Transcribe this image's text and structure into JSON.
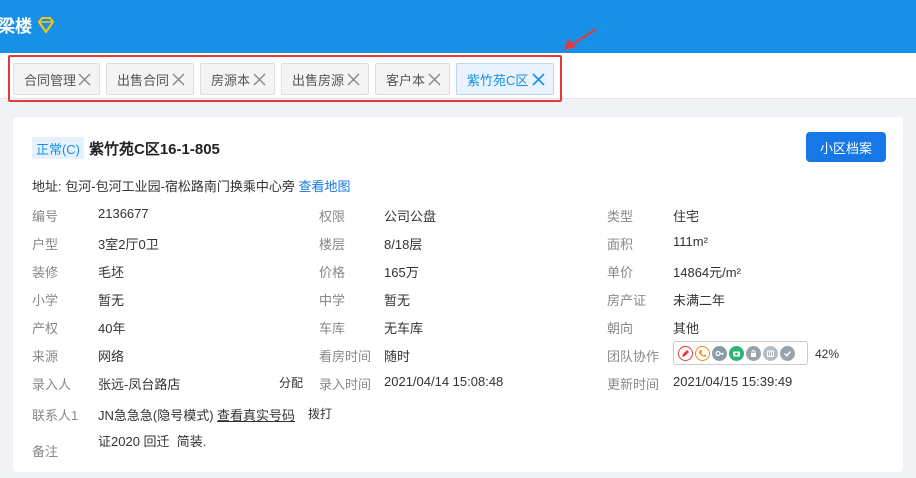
{
  "app": {
    "title": "梁楼"
  },
  "tabs": [
    {
      "label": "合同管理"
    },
    {
      "label": "出售合同"
    },
    {
      "label": "房源本"
    },
    {
      "label": "出售房源"
    },
    {
      "label": "客户本"
    },
    {
      "label": "紫竹苑C区",
      "active": true
    }
  ],
  "header": {
    "status_badge": "正常(C)",
    "title": "紫竹苑C区16-1-805",
    "archive_button": "小区档案"
  },
  "address": {
    "label": "地址:",
    "value": "包河-包河工业园-宿松路南门换乘中心旁",
    "map_link": "查看地图"
  },
  "fields": {
    "col1": [
      {
        "label": "编号",
        "value": "2136677"
      },
      {
        "label": "户型",
        "value": "3室2厅0卫"
      },
      {
        "label": "装修",
        "value": "毛坯"
      },
      {
        "label": "小学",
        "value": "暂无"
      },
      {
        "label": "产权",
        "value": "40年"
      },
      {
        "label": "来源",
        "value": "网络"
      },
      {
        "label": "录入人",
        "value": "张远-凤台路店",
        "action": "分配"
      }
    ],
    "col2": [
      {
        "label": "权限",
        "value": "公司公盘"
      },
      {
        "label": "楼层",
        "value": "8/18层"
      },
      {
        "label": "价格",
        "value": "165万"
      },
      {
        "label": "中学",
        "value": "暂无"
      },
      {
        "label": "车库",
        "value": "无车库"
      },
      {
        "label": "看房时间",
        "value": "随时"
      },
      {
        "label": "录入时间",
        "value": "2021/04/14 15:08:48"
      }
    ],
    "col3": [
      {
        "label": "类型",
        "value": "住宅"
      },
      {
        "label": "面积",
        "value": "111m²"
      },
      {
        "label": "单价",
        "value": "14864元/m²"
      },
      {
        "label": "房产证",
        "value": "未满二年"
      },
      {
        "label": "朝向",
        "value": "其他"
      },
      {
        "label": "团队协作",
        "value": "42%"
      },
      {
        "label": "更新时间",
        "value": "2021/04/15 15:39:49"
      }
    ]
  },
  "contact": {
    "label": "联系人1",
    "name": "JN急急急(隐号模式)",
    "reveal_link": "查看真实号码",
    "dial_link": "拨打"
  },
  "remark": {
    "label": "备注",
    "value": "证2020 回迁  简装."
  },
  "team_icons": [
    {
      "icon": "pen-icon",
      "color": "#e5383b"
    },
    {
      "icon": "phone-icon",
      "color": "#f08c1a"
    },
    {
      "icon": "key-icon",
      "color": "#8a9aa8"
    },
    {
      "icon": "camera-icon",
      "color": "#2bb673"
    },
    {
      "icon": "lock-icon",
      "color": "#9aa3ab"
    },
    {
      "icon": "shop-icon",
      "color": "#b5bcc3"
    },
    {
      "icon": "check-icon",
      "color": "#9aa3ab"
    }
  ],
  "colors": {
    "primary": "#1890e6",
    "highlight": "#e5383b"
  }
}
